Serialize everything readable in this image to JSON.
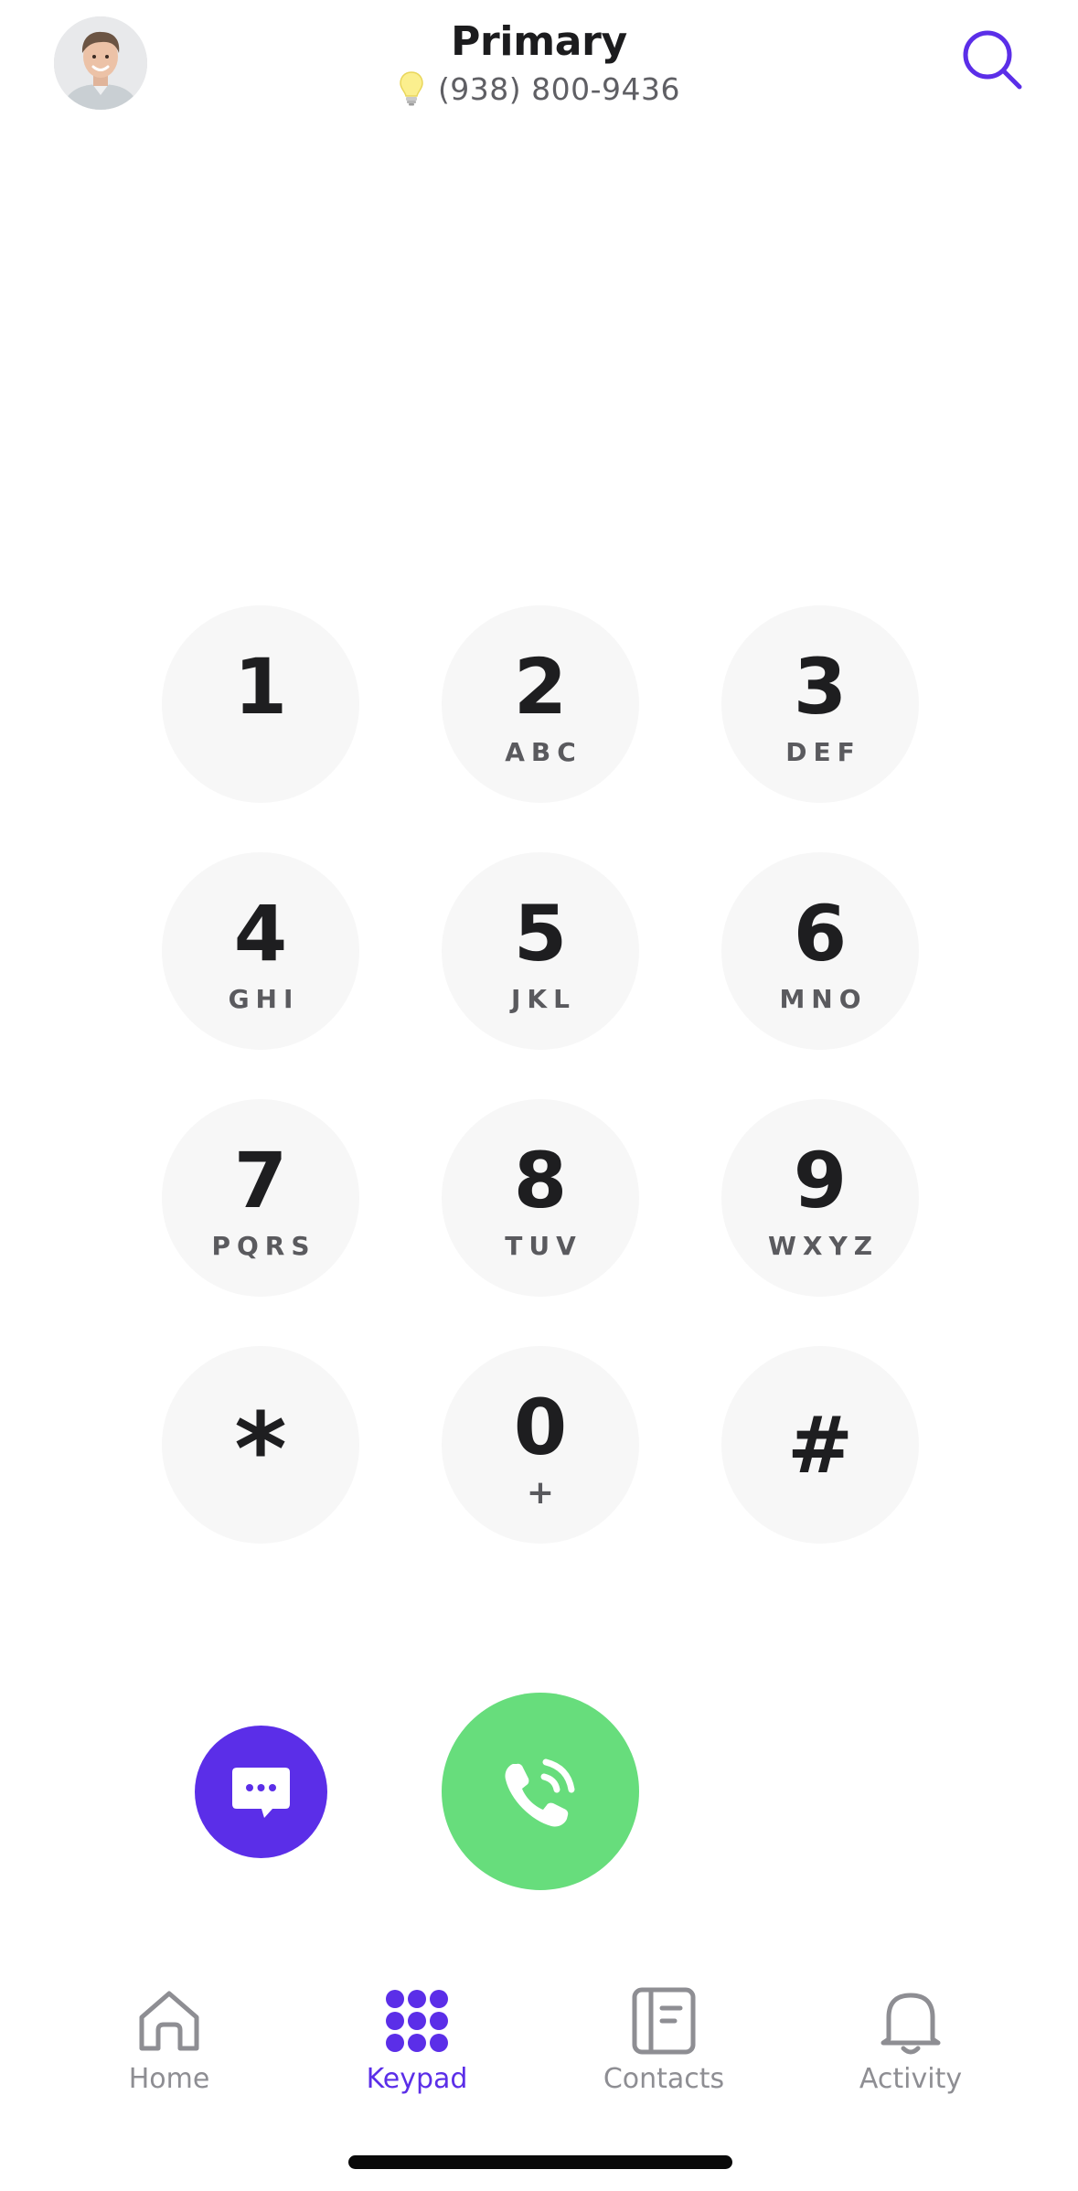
{
  "header": {
    "line_name": "Primary",
    "phone_number": "(938) 800-9436",
    "avatar_icon": "user-avatar-photo",
    "bulb_icon": "lightbulb-icon",
    "search_icon": "search-icon"
  },
  "keypad": {
    "keys": [
      {
        "digit": "1",
        "letters": ""
      },
      {
        "digit": "2",
        "letters": "ABC"
      },
      {
        "digit": "3",
        "letters": "DEF"
      },
      {
        "digit": "4",
        "letters": "GHI"
      },
      {
        "digit": "5",
        "letters": "JKL"
      },
      {
        "digit": "6",
        "letters": "MNO"
      },
      {
        "digit": "7",
        "letters": "PQRS"
      },
      {
        "digit": "8",
        "letters": "TUV"
      },
      {
        "digit": "9",
        "letters": "WXYZ"
      },
      {
        "digit": "*",
        "letters": ""
      },
      {
        "digit": "0",
        "letters": "+"
      },
      {
        "digit": "#",
        "letters": ""
      }
    ]
  },
  "actions": {
    "message_icon": "message-bubble-icon",
    "call_icon": "phone-call-icon"
  },
  "tabbar": {
    "tabs": [
      {
        "label": "Home",
        "icon": "home-icon",
        "active": false
      },
      {
        "label": "Keypad",
        "icon": "keypad-icon",
        "active": true
      },
      {
        "label": "Contacts",
        "icon": "contacts-book-icon",
        "active": false
      },
      {
        "label": "Activity",
        "icon": "bell-icon",
        "active": false
      }
    ]
  },
  "colors": {
    "accent_purple": "#5b2ee8",
    "call_green": "#67dd7c",
    "key_background": "#f7f7f7",
    "inactive_tab": "#8e8e93"
  }
}
